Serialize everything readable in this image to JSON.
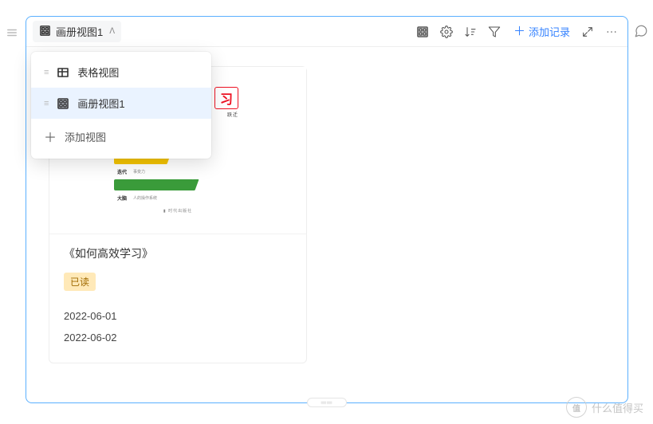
{
  "toolbar": {
    "current_view_label": "画册视图1",
    "add_record_label": "添加记录"
  },
  "view_menu": {
    "items": [
      {
        "label": "表格视图",
        "type": "table",
        "active": false
      },
      {
        "label": "画册视图1",
        "type": "gallery",
        "active": true
      }
    ],
    "add_view_label": "添加视图"
  },
  "card": {
    "title": "《如何高效学习》",
    "status_badge": "已读",
    "dates": [
      "2022-06-01",
      "2022-06-02"
    ],
    "cover": {
      "logo_char": "习",
      "logo_sub": "跃迁"
    }
  },
  "watermark": {
    "brand_text": "什么值得买",
    "logo_text": "值"
  }
}
